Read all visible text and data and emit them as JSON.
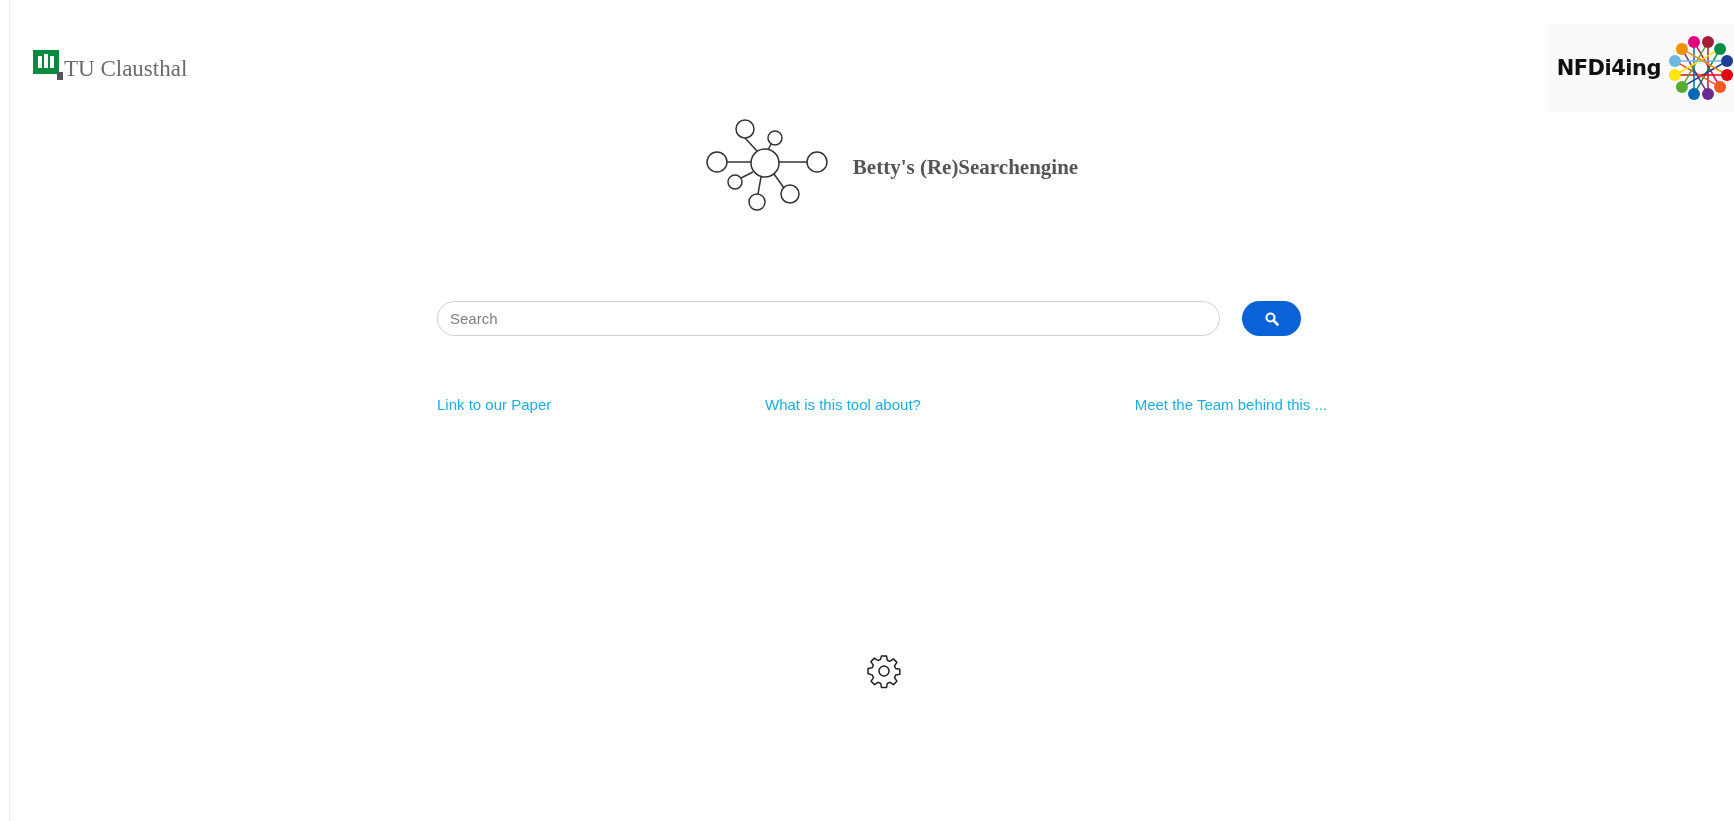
{
  "header": {
    "left_logo": {
      "text": "TU Clausthal"
    },
    "right_logo": {
      "text": "NFDi4ing"
    }
  },
  "brand": {
    "title": "Betty's (Re)Searchengine"
  },
  "search": {
    "placeholder": "Search"
  },
  "links": [
    {
      "label": "Link to our Paper"
    },
    {
      "label": "What is this tool about?"
    },
    {
      "label": "Meet the Team behind this ..."
    }
  ]
}
